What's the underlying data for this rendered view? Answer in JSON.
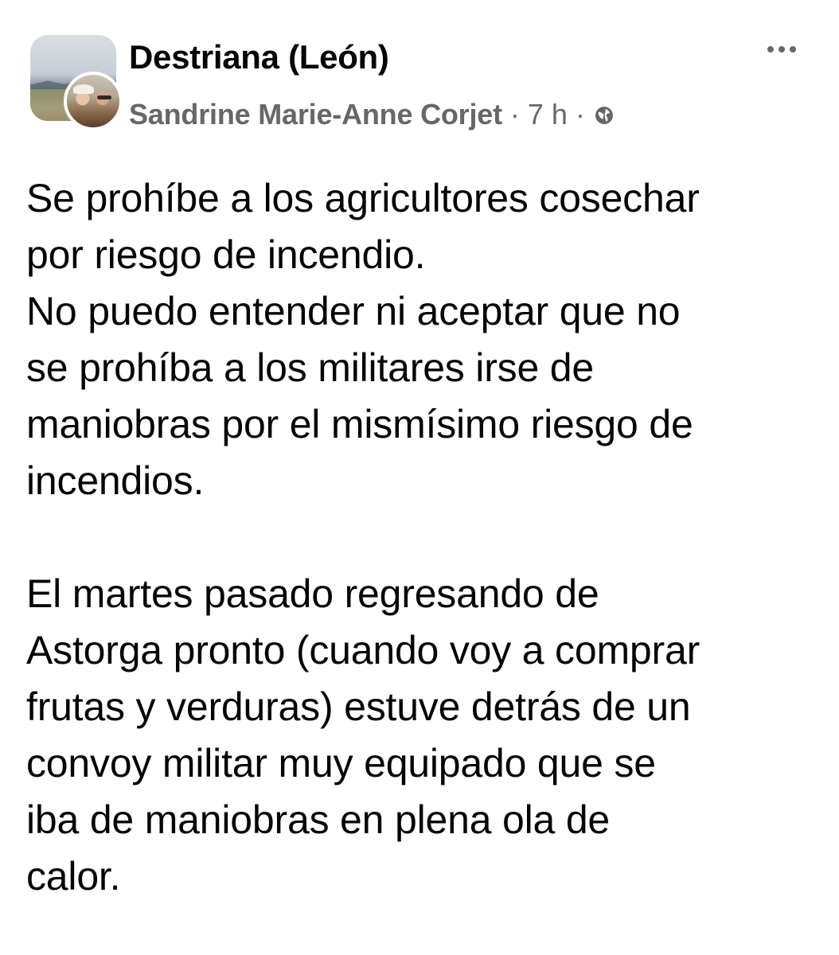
{
  "header": {
    "group_name": "Destriana (León)",
    "author": "Sandrine Marie-Anne Corjet",
    "separator": "·",
    "timestamp": "7 h",
    "audience_icon": "globe-icon",
    "more_icon": "more-options-icon"
  },
  "post": {
    "paragraph1_lines": [
      "Se prohíbe a los agricultores cosechar",
      "por riesgo de incendio.",
      "No puedo entender ni aceptar que no",
      "se prohíba a los militares irse de",
      "maniobras por el mismísimo riesgo de",
      "incendios."
    ],
    "paragraph2_lines": [
      "El martes pasado regresando de",
      "Astorga pronto (cuando voy a comprar",
      "frutas y verduras) estuve detrás de un",
      "convoy militar muy equipado que se",
      "iba de maniobras en plena ola de",
      "calor."
    ]
  },
  "colors": {
    "text_primary": "#050505",
    "text_secondary": "#65676b",
    "background": "#ffffff"
  }
}
